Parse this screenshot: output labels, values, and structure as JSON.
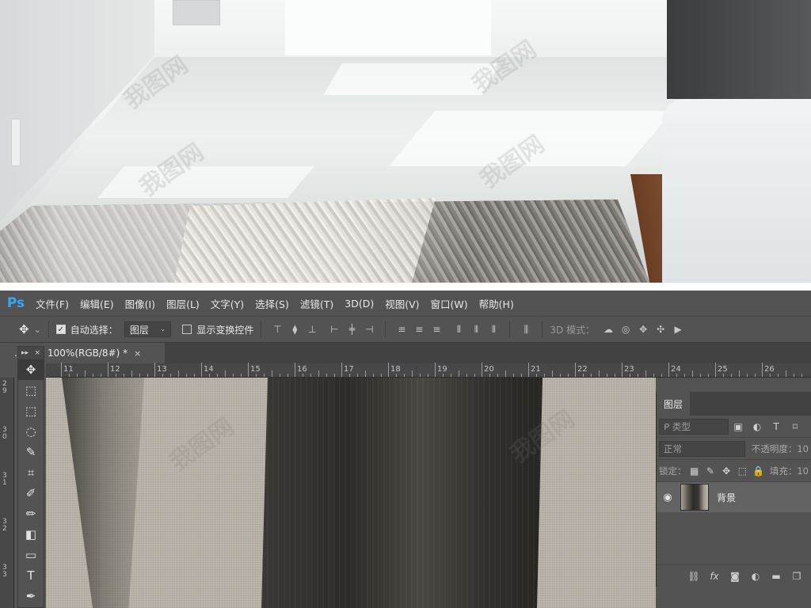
{
  "photo": {
    "watermark": "我图网"
  },
  "app": {
    "logo": "Ps",
    "menu": [
      "文件(F)",
      "编辑(E)",
      "图像(I)",
      "图层(L)",
      "文字(Y)",
      "选择(S)",
      "滤镜(T)",
      "3D(D)",
      "视图(V)",
      "窗口(W)",
      "帮助(H)"
    ]
  },
  "options": {
    "move_icon": "✥",
    "move_caret": "⌄",
    "auto_select_label": "自动选择：",
    "auto_select_value": "图层",
    "show_transform_label": "显示变换控件",
    "mode_3d_label": "3D 模式："
  },
  "document": {
    "tab_title": ".jpg @ 100%(RGB/8#) *",
    "tab_close": "×"
  },
  "rulers": {
    "horizontal": [
      "11",
      "12",
      "13",
      "14",
      "15",
      "16",
      "17",
      "18",
      "19",
      "20",
      "21",
      "22",
      "23",
      "24",
      "25",
      "26"
    ],
    "vertical": [
      "29",
      "30",
      "31",
      "32",
      "33"
    ]
  },
  "toolbox": {
    "collapse": "▸▸",
    "close": "×",
    "tools": [
      {
        "name": "move-tool",
        "glyph": "✥"
      },
      {
        "name": "artboard-tool",
        "glyph": "⬚"
      },
      {
        "name": "marquee-tool",
        "glyph": "⬚"
      },
      {
        "name": "lasso-tool",
        "glyph": "◌"
      },
      {
        "name": "quick-select-tool",
        "glyph": "✎"
      },
      {
        "name": "crop-tool",
        "glyph": "⌗"
      },
      {
        "name": "eyedropper-tool",
        "glyph": "✐"
      },
      {
        "name": "brush-tool",
        "glyph": "✏"
      },
      {
        "name": "eraser-tool",
        "glyph": "◧"
      },
      {
        "name": "gradient-tool",
        "glyph": "▭"
      },
      {
        "name": "type-tool",
        "glyph": "T"
      },
      {
        "name": "pen-tool",
        "glyph": "✒"
      }
    ]
  },
  "layers_panel": {
    "tab_label": "图层",
    "filter_placeholder": "ᑭ 类型",
    "blend_mode": "正常",
    "opacity_label": "不透明度：",
    "opacity_value": "10",
    "lock_label": "锁定：",
    "fill_label": "填充：",
    "fill_value": "10",
    "layer_name": "背景",
    "eye": "👁"
  }
}
